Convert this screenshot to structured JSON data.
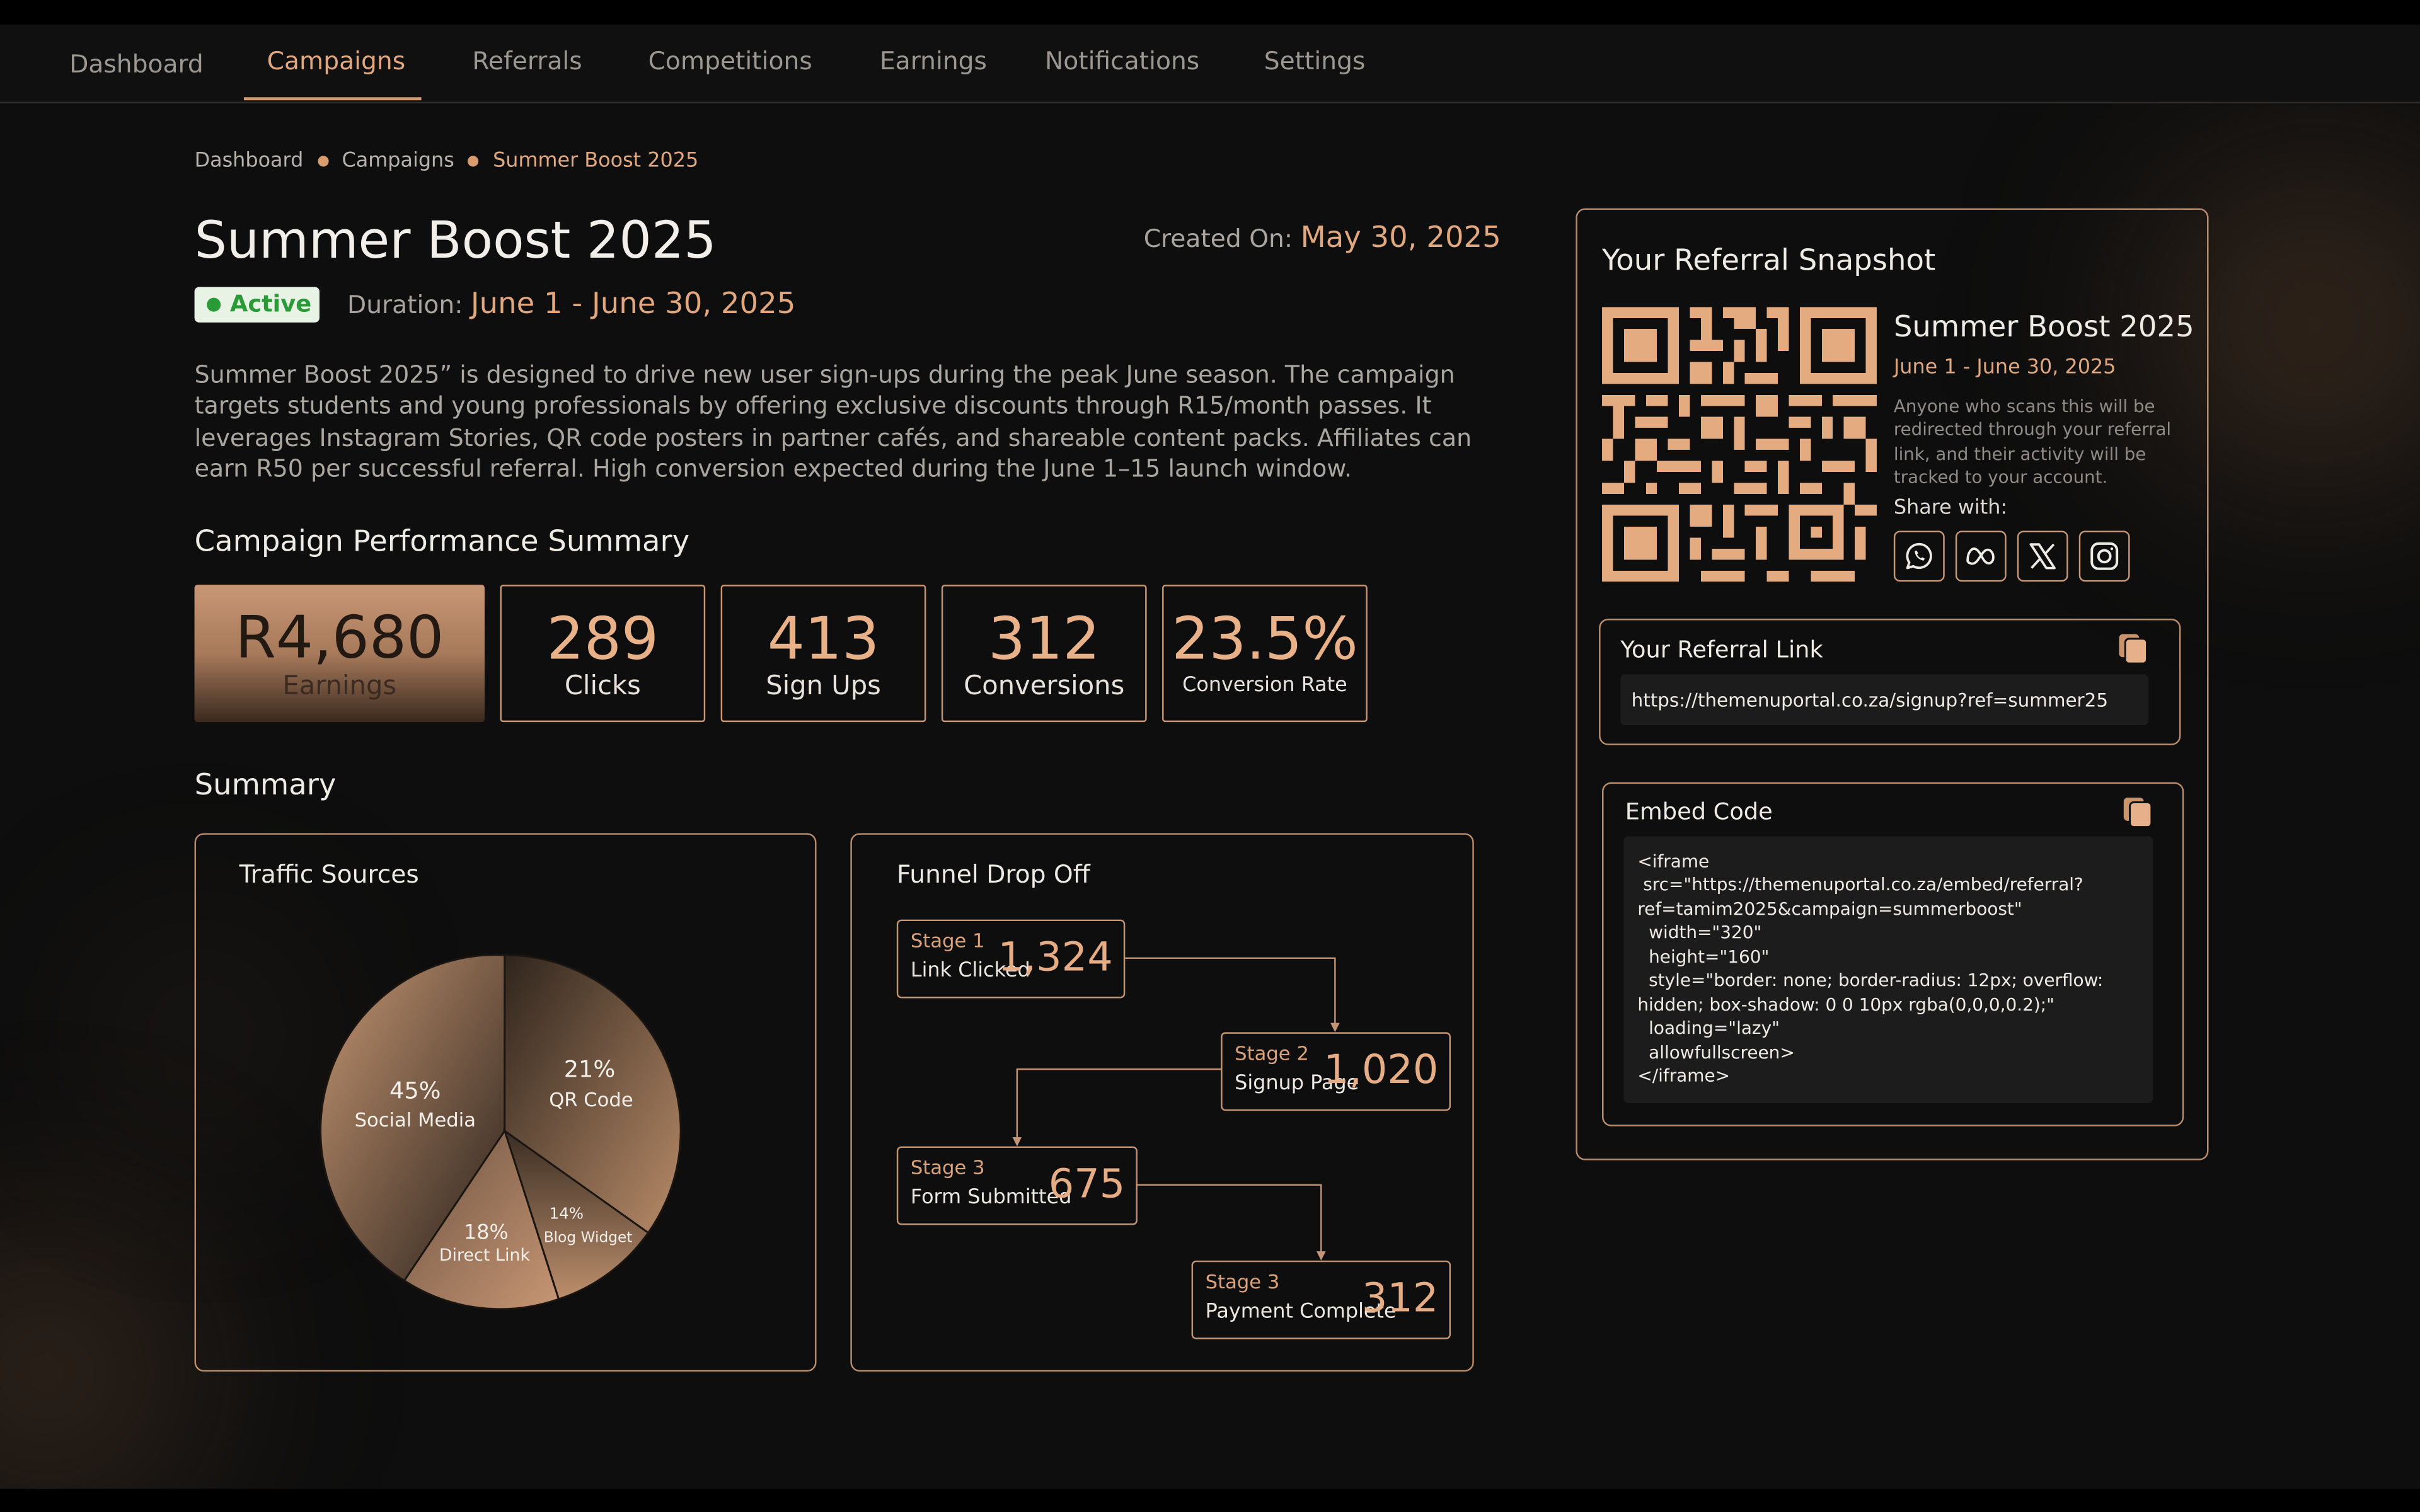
{
  "nav": {
    "items": [
      "Dashboard",
      "Campaigns",
      "Referrals",
      "Competitions",
      "Earnings",
      "Notifications",
      "Settings"
    ],
    "active": "Campaigns"
  },
  "breadcrumb": [
    "Dashboard",
    "Campaigns",
    "Summer Boost 2025"
  ],
  "campaign": {
    "title": "Summer Boost 2025",
    "created_label": "Created On:",
    "created_value": "May 30, 2025",
    "status": "Active",
    "duration_label": "Duration:",
    "duration_value": "June 1 - June 30, 2025",
    "description": "Summer Boost 2025” is designed to drive new user sign-ups during the peak June season. The campaign targets students and young professionals by offering exclusive discounts through R15/month passes. It leverages Instagram Stories, QR code posters in partner cafés, and shareable content packs. Affiliates can earn R50 per successful referral. High conversion expected during the June 1–15 launch window."
  },
  "performance": {
    "heading": "Campaign Performance Summary",
    "kpis": [
      {
        "value": "R4,680",
        "label": "Earnings"
      },
      {
        "value": "289",
        "label": "Clicks"
      },
      {
        "value": "413",
        "label": "Sign Ups"
      },
      {
        "value": "312",
        "label": "Conversions"
      },
      {
        "value": "23.5%",
        "label": "Conversion Rate"
      }
    ]
  },
  "summary_heading": "Summary",
  "traffic": {
    "title": "Traffic Sources",
    "slices": [
      {
        "pct": "45%",
        "label": "Social Media"
      },
      {
        "pct": "21%",
        "label": "QR Code"
      },
      {
        "pct": "14%",
        "label": "Blog Widget"
      },
      {
        "pct": "18%",
        "label": "Direct Link"
      }
    ]
  },
  "funnel": {
    "title": "Funnel Drop Off",
    "stages": [
      {
        "stage": "Stage 1",
        "label": "Link Clicked",
        "value": "1,324"
      },
      {
        "stage": "Stage 2",
        "label": "Signup Page",
        "value": "1,020"
      },
      {
        "stage": "Stage 3",
        "label": "Form Submitted",
        "value": "675"
      },
      {
        "stage": "Stage 3",
        "label": "Payment Complete",
        "value": "312"
      }
    ]
  },
  "chart_data": {
    "type": "pie",
    "title": "Traffic Sources",
    "categories": [
      "Social Media",
      "QR Code",
      "Blog Widget",
      "Direct Link"
    ],
    "values": [
      45,
      21,
      14,
      18
    ]
  },
  "snapshot": {
    "title": "Your Referral Snapshot",
    "campaign_name": "Summer Boost 2025",
    "dates": "June 1 - June 30, 2025",
    "note": "Anyone who scans this will be redirected through your referral link, and their activity will be tracked to your account.",
    "share_label": "Share with:",
    "share_icons": [
      "whatsapp-icon",
      "meta-icon",
      "x-icon",
      "instagram-icon"
    ],
    "link_title": "Your Referral Link",
    "link_value": "https://themenuportal.co.za/signup?ref=summer25",
    "embed_title": "Embed Code",
    "embed_code": "<iframe\n src=\"https://themenuportal.co.za/embed/referral?ref=tamim2025&campaign=summerboost\"\n  width=\"320\"\n  height=\"160\"\n  style=\"border: none; border-radius: 12px; overflow: hidden; box-shadow: 0 0 10px rgba(0,0,0,0.2);\"\n  loading=\"lazy\"\n  allowfullscreen>\n</iframe>"
  },
  "colors": {
    "accent": "#e1a77e",
    "background": "#0e0e0e",
    "active_badge": "#2a9a38"
  }
}
